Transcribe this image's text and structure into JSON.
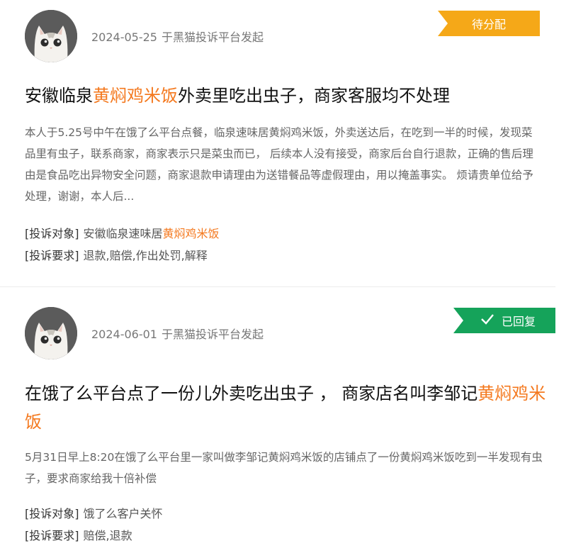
{
  "complaints": [
    {
      "date": "2024-05-25",
      "source": "于黑猫投诉平台发起",
      "status": "待分配",
      "status_color": "#f5a818",
      "title_pre": "安徽临泉",
      "title_hl": "黄焖鸡米饭",
      "title_post": "外卖里吃出虫子，商家客服均不处理",
      "description": "本人于5.25号中午在饿了么平台点餐，临泉速味居黄焖鸡米饭，外卖送达后，在吃到一半的时候，发现菜品里有虫子，联系商家，商家表示只是菜虫而已， 后续本人没有接受，商家后台自行退款，正确的售后理由是食品吃出异物安全问题，商家退款申请理由为送错餐品等虚假理由，用以掩盖事实。 烦请贵单位给予处理，谢谢，本人后...",
      "target_label": "[投诉对象]",
      "target_pre": "安徽临泉速味居",
      "target_hl": "黄焖鸡米饭",
      "demand_label": "[投诉要求]",
      "demand": "退款,赔偿,作出处罚,解释"
    },
    {
      "date": "2024-06-01",
      "source": "于黑猫投诉平台发起",
      "status": "已回复",
      "status_icon": "check-icon",
      "status_color": "#15a35a",
      "title_pre": "在饿了么平台点了一份儿外卖吃出虫子 ， 商家店名叫李邹记",
      "title_hl": "黄焖鸡米饭",
      "title_post": "",
      "description": "5月31日早上8:20在饿了么平台里一家叫做李邹记黄焖鸡米饭的店铺点了一份黄焖鸡米饭吃到一半发现有虫子，要求商家给我十倍补偿",
      "target_label": "[投诉对象]",
      "target_pre": "饿了么客户关怀",
      "target_hl": "",
      "demand_label": "[投诉要求]",
      "demand": "赔偿,退款"
    }
  ],
  "colors": {
    "highlight": "#f4791f"
  }
}
